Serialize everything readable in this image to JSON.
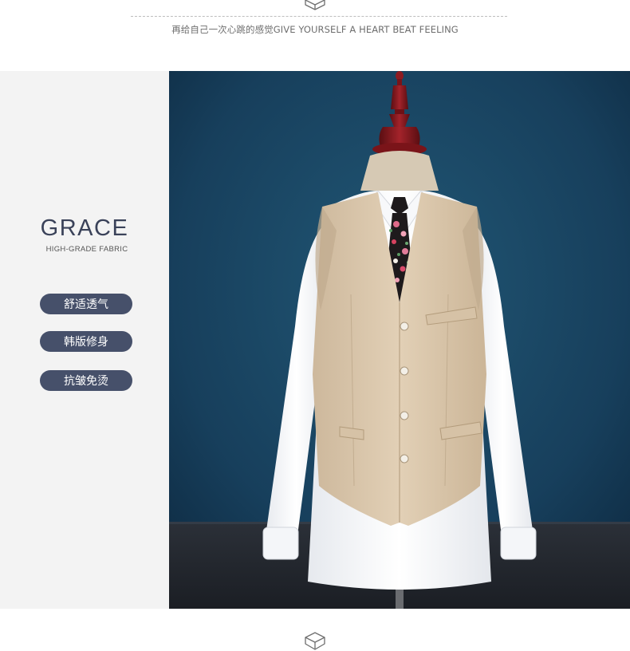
{
  "header": {
    "icon": "package-box-icon",
    "tagline": "再给自己一次心跳的感觉GIVE YOURSELF A HEART BEAT FEELING"
  },
  "brand": {
    "title": "GRACE",
    "subtitle": "HIGH-GRADE FABRIC"
  },
  "features": [
    {
      "label": "舒适透气"
    },
    {
      "label": "韩版修身"
    },
    {
      "label": "抗皱免烫"
    }
  ],
  "product_photo": {
    "subject": "beige-linen-vest-on-mannequin-icon"
  },
  "footer": {
    "icon": "package-box-icon"
  },
  "colors": {
    "pill_bg": "#46506a",
    "title": "#3a4259",
    "panel_bg": "#f3f3f3",
    "backdrop": "#1c4a68",
    "vest": "#dcc8ad"
  }
}
